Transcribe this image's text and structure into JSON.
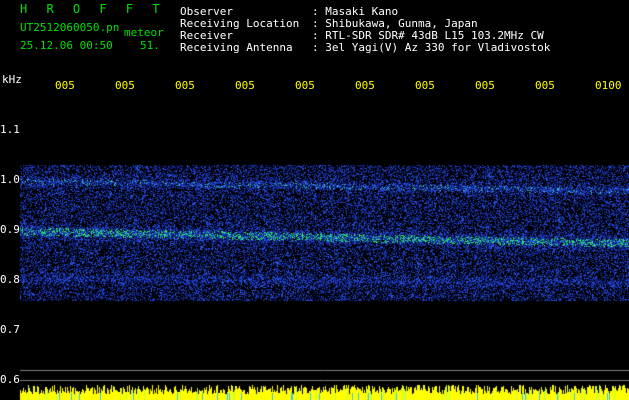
{
  "header": {
    "app_title": "H R O F F T",
    "filename": "UT2512060050.pn",
    "event_type": "meteor",
    "datetime": "25.12.06 00:50",
    "count": "51.",
    "observer_label": "Observer",
    "observer_value": ": Masaki Kano",
    "location_label": "Receiving Location",
    "location_value": ": Shibukawa, Gunma, Japan",
    "receiver_label": "Receiver",
    "receiver_value": ": RTL-SDR SDR# 43dB L15 103.2MHz CW",
    "antenna_label": "Receiving Antenna",
    "antenna_value": ": 3el Yagi(V) Az 330 for Vladivostok"
  },
  "spectrogram": {
    "y_unit": "kHz",
    "y_ticks": [
      "1.1",
      "1.0",
      "0.9",
      "0.8",
      "0.7",
      "0.6"
    ],
    "time_ticks": [
      "005",
      "005",
      "005",
      "005",
      "005",
      "005",
      "005",
      "005",
      "005",
      "0100"
    ],
    "colors": {
      "background": "#000000",
      "axis_text": "#ffffff",
      "time_text": "#ffff00",
      "noise_band": "#1f2fd0",
      "hot_band": "#30ff80",
      "power_bar": "#ffff00"
    }
  }
}
